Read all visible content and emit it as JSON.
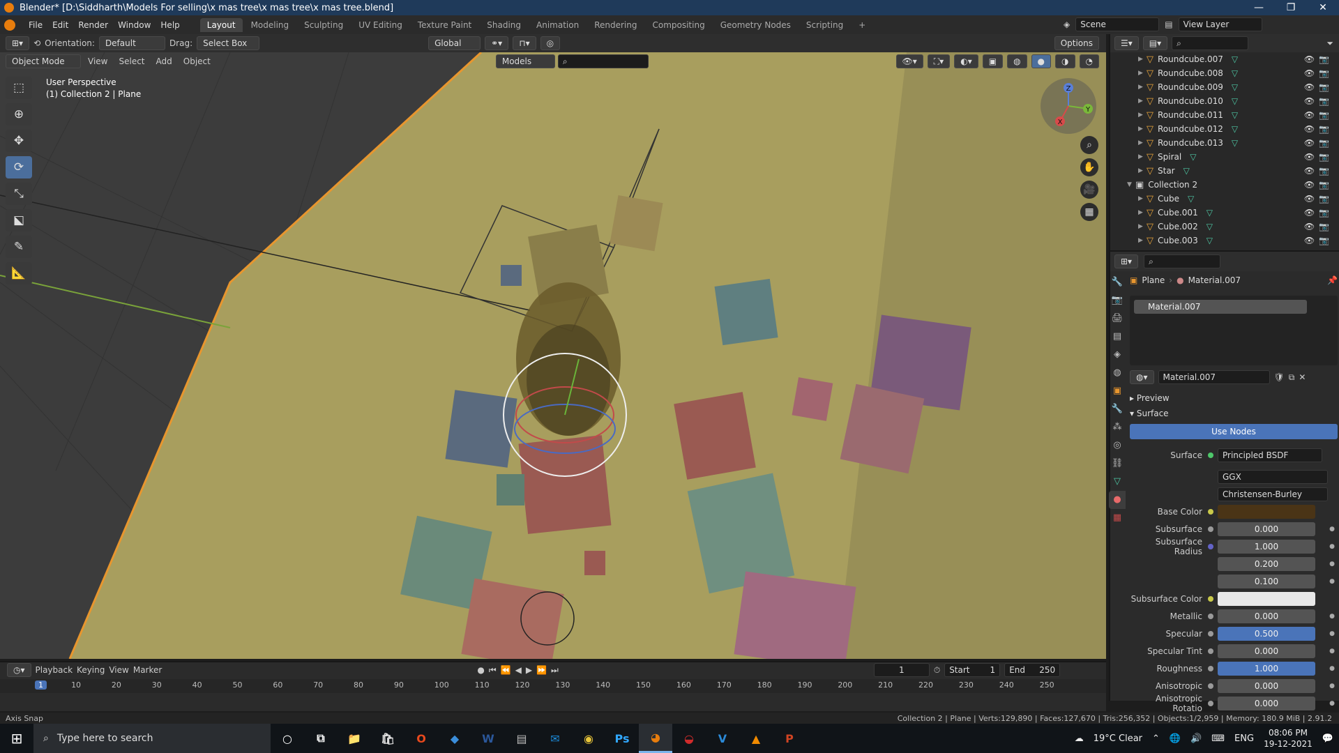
{
  "window": {
    "title": "Blender* [D:\\Siddharth\\Models For selling\\x mas tree\\x mas tree\\x mas tree.blend]",
    "controls": [
      "—",
      "❐",
      "✕"
    ]
  },
  "menu": {
    "items": [
      "File",
      "Edit",
      "Render",
      "Window",
      "Help"
    ],
    "workspaces": [
      "Layout",
      "Modeling",
      "Sculpting",
      "UV Editing",
      "Texture Paint",
      "Shading",
      "Animation",
      "Rendering",
      "Compositing",
      "Geometry Nodes",
      "Scripting"
    ],
    "add_tab": "+",
    "scene": "Scene",
    "view_layer": "View Layer"
  },
  "vp_header": {
    "orientation_label": "Orientation:",
    "orientation": "Default",
    "drag_label": "Drag:",
    "drag": "Select Box",
    "transform": "Global",
    "options": "Options"
  },
  "vp_header2": {
    "mode": "Object Mode",
    "items": [
      "View",
      "Select",
      "Add",
      "Object"
    ],
    "collection": "Models"
  },
  "viewport": {
    "info_line1": "User Perspective",
    "info_line2": "(1) Collection 2 | Plane",
    "axis_x": "X",
    "axis_y": "Y",
    "axis_z": "Z",
    "gift_colors": [
      "#9a5a52",
      "#5f7f80",
      "#6f8f80",
      "#7a5a7a",
      "#9a6a6f",
      "#8a7e4a",
      "#5a6a7e"
    ]
  },
  "tools": [
    "⬚",
    "⊕",
    "✥",
    "⟳",
    "⤡",
    "⬕",
    "✎",
    "📐"
  ],
  "outliner": {
    "rows": [
      {
        "name": "Roundcube.007",
        "type": "obj"
      },
      {
        "name": "Roundcube.008",
        "type": "obj"
      },
      {
        "name": "Roundcube.009",
        "type": "obj"
      },
      {
        "name": "Roundcube.010",
        "type": "obj"
      },
      {
        "name": "Roundcube.011",
        "type": "obj"
      },
      {
        "name": "Roundcube.012",
        "type": "obj"
      },
      {
        "name": "Roundcube.013",
        "type": "obj"
      },
      {
        "name": "Spiral",
        "type": "obj"
      },
      {
        "name": "Star",
        "type": "obj"
      },
      {
        "name": "Collection 2",
        "type": "coll"
      },
      {
        "name": "Cube",
        "type": "obj"
      },
      {
        "name": "Cube.001",
        "type": "obj"
      },
      {
        "name": "Cube.002",
        "type": "obj"
      },
      {
        "name": "Cube.003",
        "type": "obj"
      }
    ]
  },
  "properties": {
    "object": "Plane",
    "material": "Material.007",
    "slot": "Material.007",
    "preview": "Preview",
    "surface": "Surface",
    "use_nodes": "Use Nodes",
    "surface_label": "Surface",
    "surface_value": "Principled BSDF",
    "distribution": "GGX",
    "subsurface_method": "Christensen-Burley",
    "base_color_label": "Base Color",
    "base_color": "#4a3416",
    "subsurface_color_label": "Subsurface Color",
    "subsurface_color": "#e8e8e8",
    "fields": [
      {
        "label": "Subsurface",
        "value": "0.000"
      },
      {
        "label": "Subsurface Radius",
        "value": "1.000"
      },
      {
        "label": "",
        "value": "0.200"
      },
      {
        "label": "",
        "value": "0.100"
      },
      {
        "label": "Metallic",
        "value": "0.000"
      },
      {
        "label": "Specular",
        "value": "0.500"
      },
      {
        "label": "Specular Tint",
        "value": "0.000"
      },
      {
        "label": "Roughness",
        "value": "1.000"
      },
      {
        "label": "Anisotropic",
        "value": "0.000"
      },
      {
        "label": "Anisotropic Rotatio",
        "value": "0.000"
      }
    ]
  },
  "timeline": {
    "items": [
      "Playback",
      "Keying",
      "View",
      "Marker"
    ],
    "current_frame": "1",
    "start_label": "Start",
    "start": "1",
    "end_label": "End",
    "end": "250",
    "ticks": [
      "1",
      "10",
      "20",
      "30",
      "40",
      "50",
      "60",
      "70",
      "80",
      "90",
      "100",
      "110",
      "120",
      "130",
      "140",
      "150",
      "160",
      "170",
      "180",
      "190",
      "200",
      "210",
      "220",
      "230",
      "240",
      "250"
    ]
  },
  "status": {
    "left": "Axis Snap",
    "right": "Collection 2 | Plane | Verts:129,890 | Faces:127,670 | Tris:256,352 | Objects:1/2,959 | Memory: 180.9 MiB | 2.91.2"
  },
  "taskbar": {
    "search_placeholder": "Type here to search",
    "weather": "19°C  Clear",
    "lang": "ENG",
    "time": "08:06 PM",
    "date": "19-12-2021",
    "apps": [
      {
        "name": "explorer",
        "glyph": "📁",
        "color": "#f3c13a"
      },
      {
        "name": "store",
        "glyph": "🛍",
        "color": "#ddd"
      },
      {
        "name": "office",
        "glyph": "O",
        "color": "#e8491d"
      },
      {
        "name": "app",
        "glyph": "◆",
        "color": "#3b8edb"
      },
      {
        "name": "word",
        "glyph": "W",
        "color": "#2b579a"
      },
      {
        "name": "app2",
        "glyph": "▤",
        "color": "#bbb"
      },
      {
        "name": "mail",
        "glyph": "✉",
        "color": "#1c8ad8"
      },
      {
        "name": "chrome",
        "glyph": "◉",
        "color": "#e8c53a"
      },
      {
        "name": "photoshop",
        "glyph": "Ps",
        "color": "#31a8ff"
      },
      {
        "name": "blender",
        "glyph": "◕",
        "color": "#e87d0d",
        "active": true
      },
      {
        "name": "app3",
        "glyph": "◒",
        "color": "#d02b2b"
      },
      {
        "name": "app4",
        "glyph": "V",
        "color": "#2b8ad8"
      },
      {
        "name": "vlc",
        "glyph": "▲",
        "color": "#f08a00"
      },
      {
        "name": "powerpoint",
        "glyph": "P",
        "color": "#d04423"
      }
    ]
  }
}
